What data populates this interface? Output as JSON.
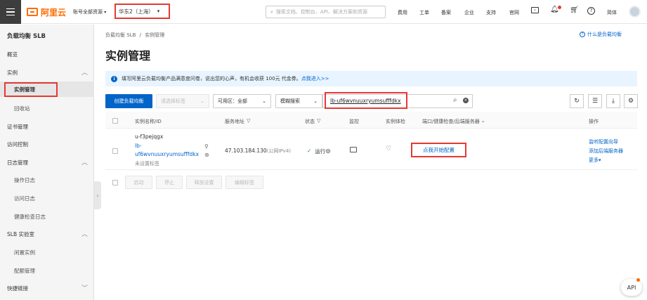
{
  "topbar": {
    "logo_text": "阿里云",
    "account_label": "账号全部资源",
    "region": "华东2（上海）",
    "search_placeholder": "搜索文档、控制台、API、解决方案和资源",
    "nav": [
      "费用",
      "工单",
      "备案",
      "企业",
      "支持",
      "官网"
    ],
    "lang": "简体"
  },
  "sidebar": {
    "title": "负载均衡 SLB",
    "overview": "概览",
    "instance_group": "实例",
    "instance_mgmt": "实例管理",
    "recycle": "回收站",
    "cert": "证书管理",
    "access": "访问控制",
    "log_group": "日志管理",
    "op_log": "操作日志",
    "access_log": "访问日志",
    "health_log": "健康检查日志",
    "lab_group": "SLB 实验室",
    "idle": "闲置实例",
    "quota": "配额管理",
    "quick": "快捷链接"
  },
  "breadcrumb": {
    "root": "负载均衡 SLB",
    "sep": "/",
    "current": "实例管理"
  },
  "help_link": "什么是负载均衡",
  "page_title": "实例管理",
  "notice": {
    "text": "填写阿里云负载均衡产品满意度问卷，说出您的心声，有机会收获 100元 代金券。",
    "link": "点我进入>>"
  },
  "toolbar": {
    "create": "创建负载均衡",
    "select_tag": "请选择标签",
    "zone_label": "可用区：",
    "zone_value": "全部",
    "search_mode": "模糊搜索",
    "search_value": "lb-uf6wvnuuxryumsufffdkx"
  },
  "table": {
    "headers": [
      "实例名称/ID",
      "服务地址",
      "状态",
      "监控",
      "实例体检",
      "端口/健康检查/后端服务器",
      "操作"
    ],
    "row": {
      "name": "u-f3pejqgx",
      "id_line1": "lb-",
      "id_line2": "uf6wvnuuxryumsufffdkx",
      "tag": "未设置标签",
      "address": "47.103.184.130",
      "addr_type": "(公网IPv4)",
      "status": "运行中",
      "config_link": "点我开始配置",
      "ops": [
        "监听配置向导",
        "添加后端服务器",
        "更多"
      ]
    }
  },
  "batch": [
    "启动",
    "停止",
    "释放设置",
    "编辑标签"
  ],
  "api_button": "API"
}
